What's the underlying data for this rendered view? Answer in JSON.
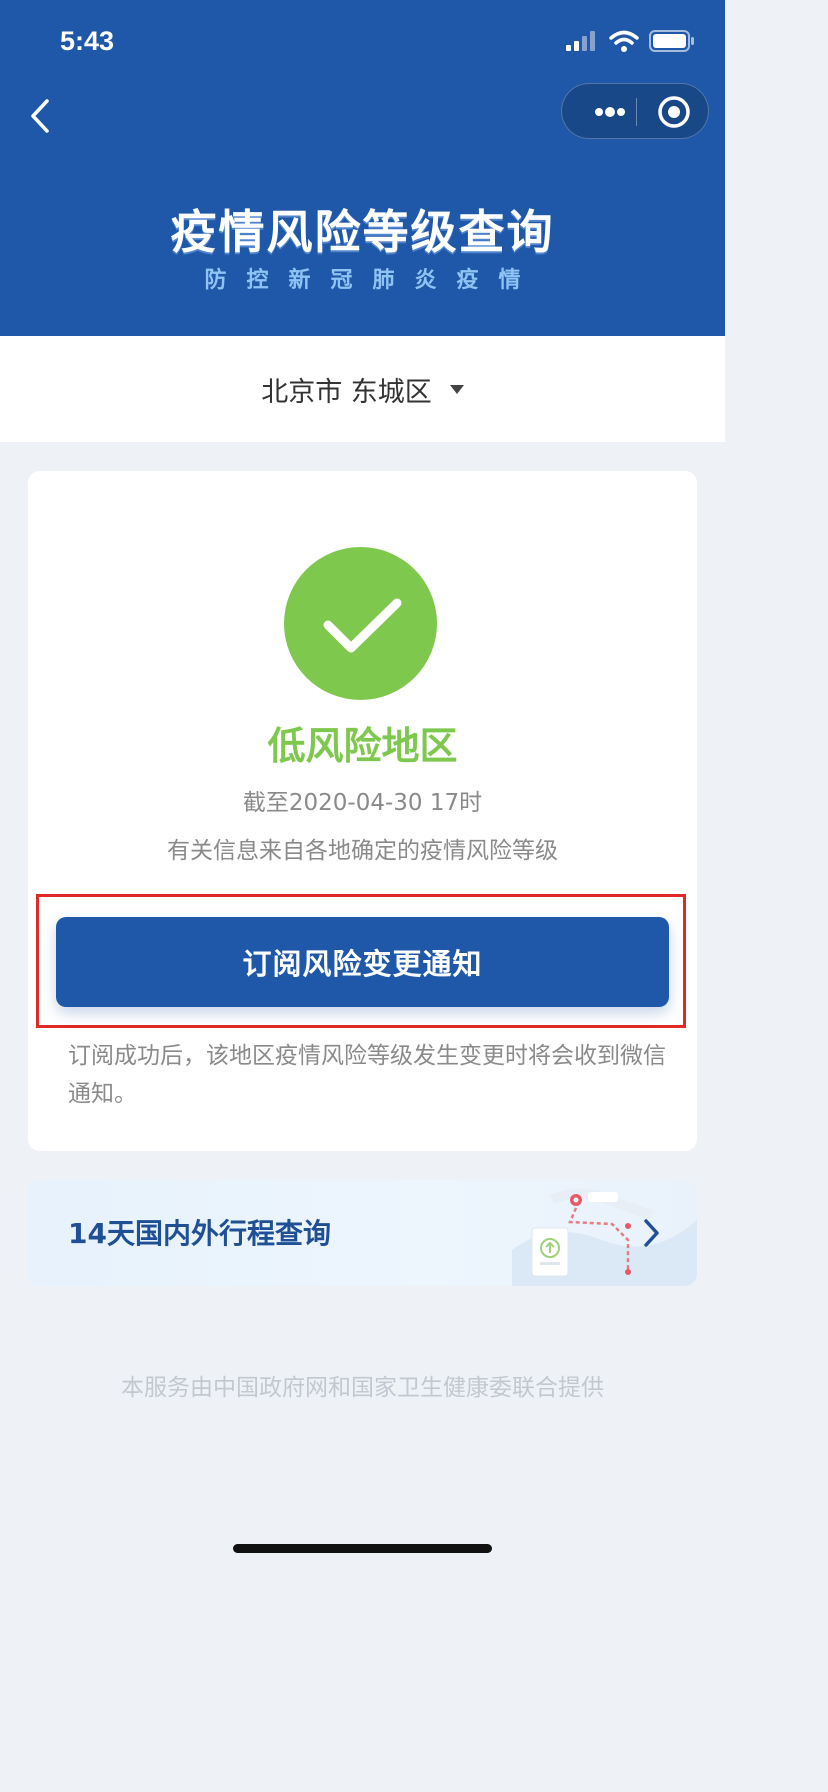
{
  "status_bar": {
    "time": "5:43"
  },
  "header": {
    "title": "疫情风险等级查询",
    "subtitle": "防控新冠肺炎疫情"
  },
  "location": {
    "value": "北京市 东城区"
  },
  "risk": {
    "level": "低风险地区",
    "as_of": "截至2020-04-30 17时",
    "source_note": "有关信息来自各地确定的疫情风险等级",
    "status_color": "#7ec84e"
  },
  "subscribe": {
    "button_label": "订阅风险变更通知",
    "note": "订阅成功后，该地区疫情风险等级发生变更时将会收到微信通知。"
  },
  "travel": {
    "label": "14天国内外行程查询"
  },
  "footer": {
    "text": "本服务由中国政府网和国家卫生健康委联合提供"
  },
  "colors": {
    "brand_blue": "#1f58a8",
    "highlight_red": "#e02a26"
  },
  "icons": [
    "back-icon",
    "more-icon",
    "close-mini-program-icon",
    "checkmark-icon",
    "dropdown-arrow-icon",
    "chevron-right-icon",
    "signal-icon",
    "wifi-icon",
    "battery-icon"
  ]
}
